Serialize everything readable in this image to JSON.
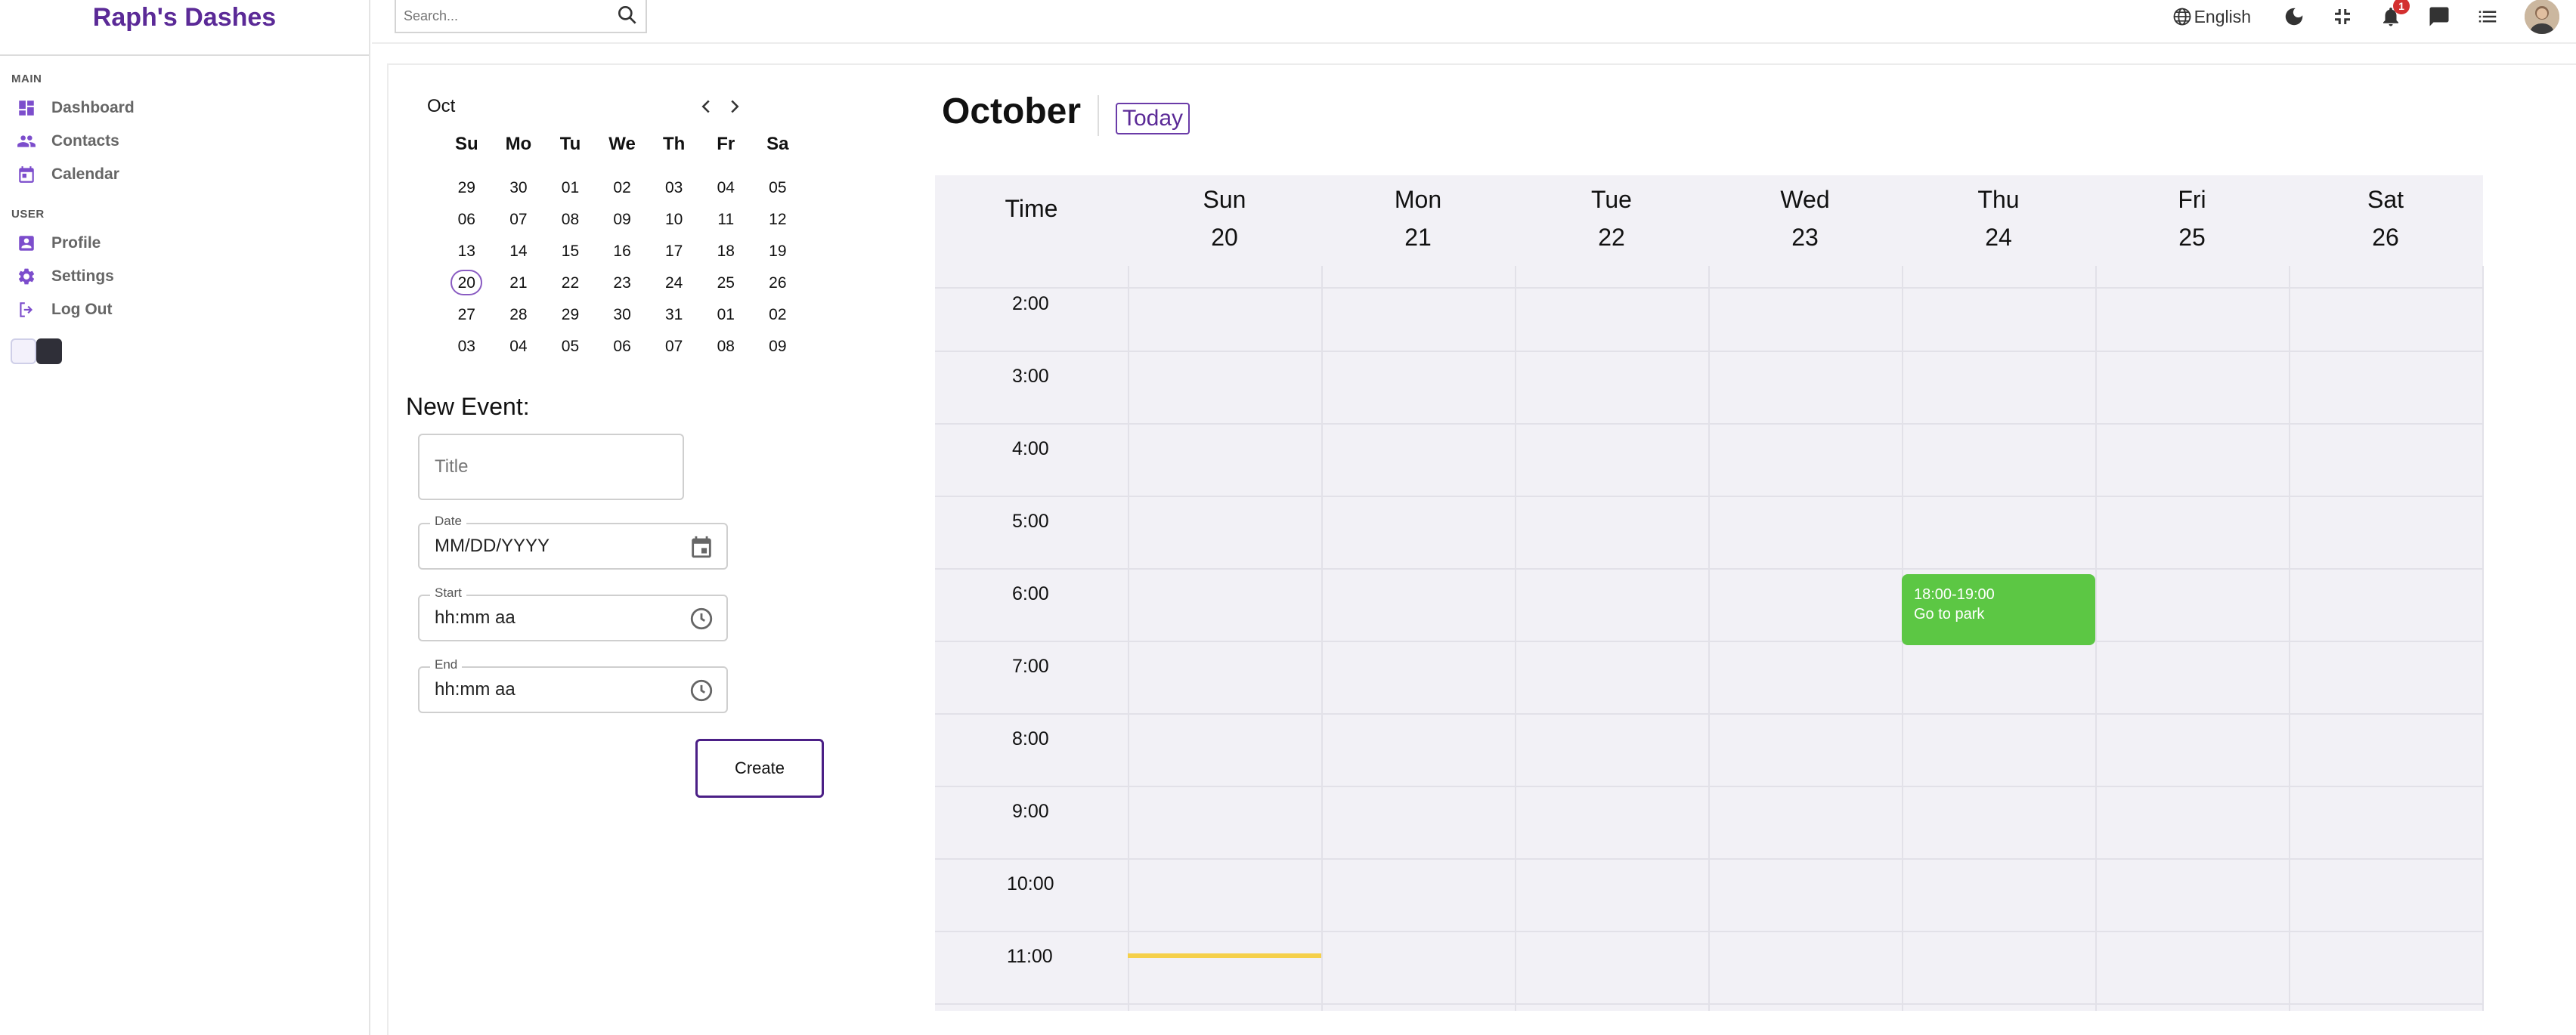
{
  "app": {
    "brand": "Raph's Dashes"
  },
  "sidebar": {
    "sections": [
      {
        "title": "MAIN",
        "items": [
          {
            "label": "Dashboard",
            "icon": "dashboard-icon"
          },
          {
            "label": "Contacts",
            "icon": "people-icon"
          },
          {
            "label": "Calendar",
            "icon": "calendar-icon"
          }
        ]
      },
      {
        "title": "USER",
        "items": [
          {
            "label": "Profile",
            "icon": "profile-icon"
          },
          {
            "label": "Settings",
            "icon": "gear-icon"
          },
          {
            "label": "Log Out",
            "icon": "logout-icon"
          }
        ]
      }
    ],
    "accent_color": "#7c4dcc"
  },
  "topbar": {
    "search_placeholder": "Search...",
    "language": "English",
    "notification_count": "1"
  },
  "mini_calendar": {
    "month": "Oct",
    "weekdays": [
      "Su",
      "Mo",
      "Tu",
      "We",
      "Th",
      "Fr",
      "Sa"
    ],
    "weeks": [
      [
        "29",
        "30",
        "01",
        "02",
        "03",
        "04",
        "05"
      ],
      [
        "06",
        "07",
        "08",
        "09",
        "10",
        "11",
        "12"
      ],
      [
        "13",
        "14",
        "15",
        "16",
        "17",
        "18",
        "19"
      ],
      [
        "20",
        "21",
        "22",
        "23",
        "24",
        "25",
        "26"
      ],
      [
        "27",
        "28",
        "29",
        "30",
        "31",
        "01",
        "02"
      ],
      [
        "03",
        "04",
        "05",
        "06",
        "07",
        "08",
        "09"
      ]
    ],
    "selected": "20"
  },
  "new_event": {
    "heading": "New Event:",
    "title_placeholder": "Title",
    "date_label": "Date",
    "date_value": "MM/DD/YYYY",
    "start_label": "Start",
    "start_value": "hh:mm aa",
    "end_label": "End",
    "end_value": "hh:mm aa",
    "create_label": "Create"
  },
  "week_view": {
    "month_title": "October",
    "today_label": "Today",
    "time_header": "Time",
    "days": [
      {
        "name": "Sun",
        "date": "20"
      },
      {
        "name": "Mon",
        "date": "21"
      },
      {
        "name": "Tue",
        "date": "22"
      },
      {
        "name": "Wed",
        "date": "23"
      },
      {
        "name": "Thu",
        "date": "24"
      },
      {
        "name": "Fri",
        "date": "25"
      },
      {
        "name": "Sat",
        "date": "26"
      }
    ],
    "hours": [
      "2:00",
      "3:00",
      "4:00",
      "5:00",
      "6:00",
      "7:00",
      "8:00",
      "9:00",
      "10:00",
      "11:00"
    ],
    "events": [
      {
        "time": "18:00-19:00",
        "title": "Go to park",
        "day": "Thu",
        "color": "#5cc744"
      }
    ],
    "now_indicator_color": "#f5d04a"
  }
}
